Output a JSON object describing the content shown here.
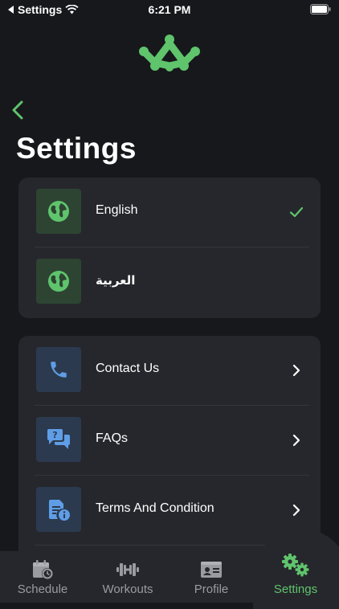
{
  "status_bar": {
    "back_app": "Settings",
    "time": "6:21 PM"
  },
  "header": {
    "title": "Settings",
    "logo": "app-logo",
    "back_icon": "chevron-left-icon"
  },
  "languages": [
    {
      "label": "English",
      "icon": "globe-icon",
      "selected": true
    },
    {
      "label": "العربية",
      "icon": "globe-icon",
      "selected": false
    }
  ],
  "links": [
    {
      "label": "Contact Us",
      "icon": "phone-icon"
    },
    {
      "label": "FAQs",
      "icon": "chat-question-icon"
    },
    {
      "label": "Terms And Condition",
      "icon": "document-info-icon"
    }
  ],
  "tabs": [
    {
      "label": "Schedule",
      "icon": "calendar-clock-icon"
    },
    {
      "label": "Workouts",
      "icon": "dumbbell-icon"
    },
    {
      "label": "Profile",
      "icon": "id-card-icon"
    },
    {
      "label": "Settings",
      "icon": "gears-icon",
      "active": true
    }
  ],
  "colors": {
    "accent": "#5fc46c",
    "background": "#17181c",
    "card": "#26272c",
    "info_icon": "#5f9de6"
  }
}
